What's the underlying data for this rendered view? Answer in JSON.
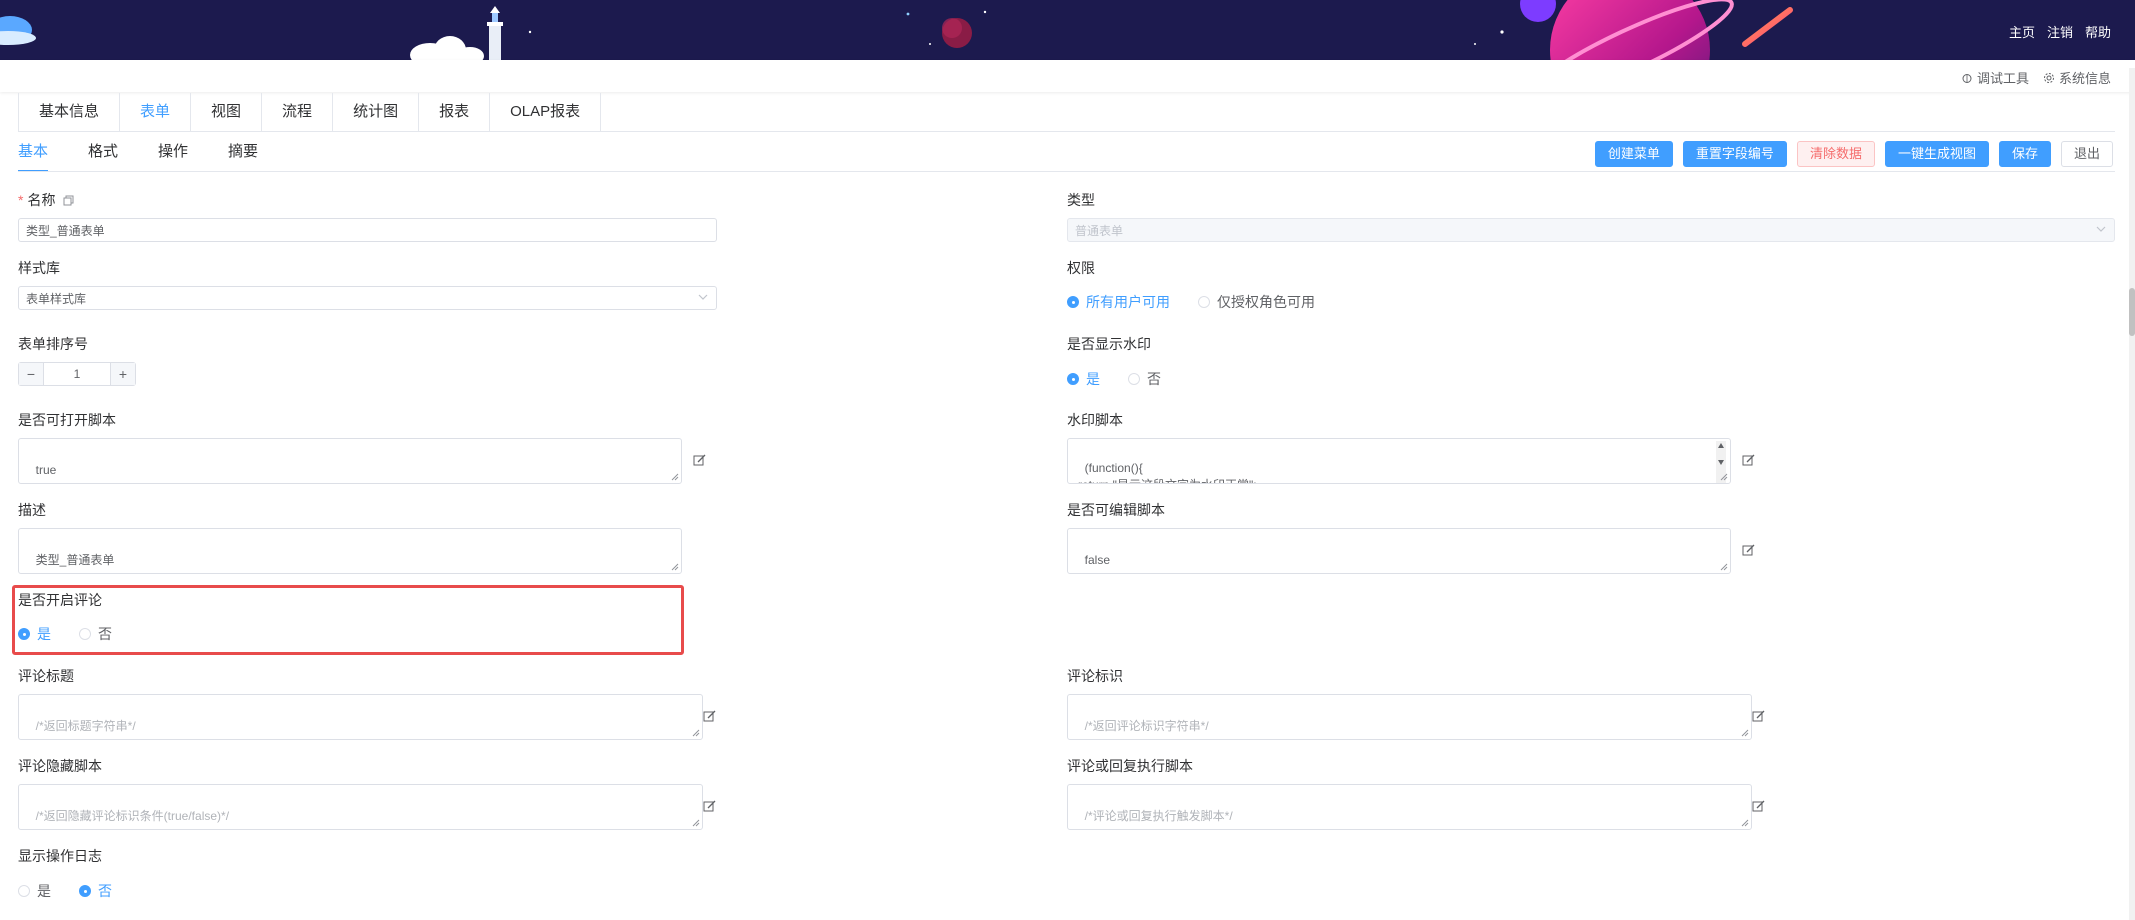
{
  "header": {
    "links": [
      "主页",
      "注销",
      "帮助"
    ]
  },
  "toolbar": {
    "debug_tool": "调试工具",
    "system_info": "系统信息"
  },
  "main_tabs": [
    "基本信息",
    "表单",
    "视图",
    "流程",
    "统计图",
    "报表",
    "OLAP报表"
  ],
  "sub_tabs": [
    "基本",
    "格式",
    "操作",
    "摘要"
  ],
  "actions": {
    "create_menu": "创建菜单",
    "reset_field_numbers": "重置字段编号",
    "clear_data": "清除数据",
    "generate_view": "一键生成视图",
    "save": "保存",
    "exit": "退出"
  },
  "form": {
    "name_label": "名称",
    "name_value": "类型_普通表单",
    "type_label": "类型",
    "type_value": "普通表单",
    "style_lib_label": "样式库",
    "style_lib_value": "表单样式库",
    "permission_label": "权限",
    "permission_options": [
      "所有用户可用",
      "仅授权角色可用"
    ],
    "sort_label": "表单排序号",
    "sort_value": "1",
    "stepper_minus": "−",
    "stepper_plus": "+",
    "watermark_label": "是否显示水印",
    "yes": "是",
    "no": "否",
    "open_script_label": "是否可打开脚本",
    "open_script_value": "true",
    "watermark_script_label": "水印脚本",
    "watermark_script_value": "(function(){\nreturn \"显示这段文字为水印正常\";\n})",
    "desc_label": "描述",
    "desc_value": "类型_普通表单",
    "editable_script_label": "是否可编辑脚本",
    "editable_script_value": "false",
    "comment_enable_label": "是否开启评论",
    "comment_title_label": "评论标题",
    "comment_title_placeholder": "/*返回标题字符串*/",
    "comment_id_label": "评论标识",
    "comment_id_placeholder": "/*返回评论标识字符串*/",
    "comment_hide_label": "评论隐藏脚本",
    "comment_hide_placeholder": "/*返回隐藏评论标识条件(true/false)*/",
    "comment_exec_label": "评论或回复执行脚本",
    "comment_exec_placeholder": "/*评论或回复执行触发脚本*/",
    "show_log_label": "显示操作日志"
  },
  "colors": {
    "primary": "#409eff",
    "banner": "#1c1a4e",
    "highlight": "#e84b4b"
  }
}
